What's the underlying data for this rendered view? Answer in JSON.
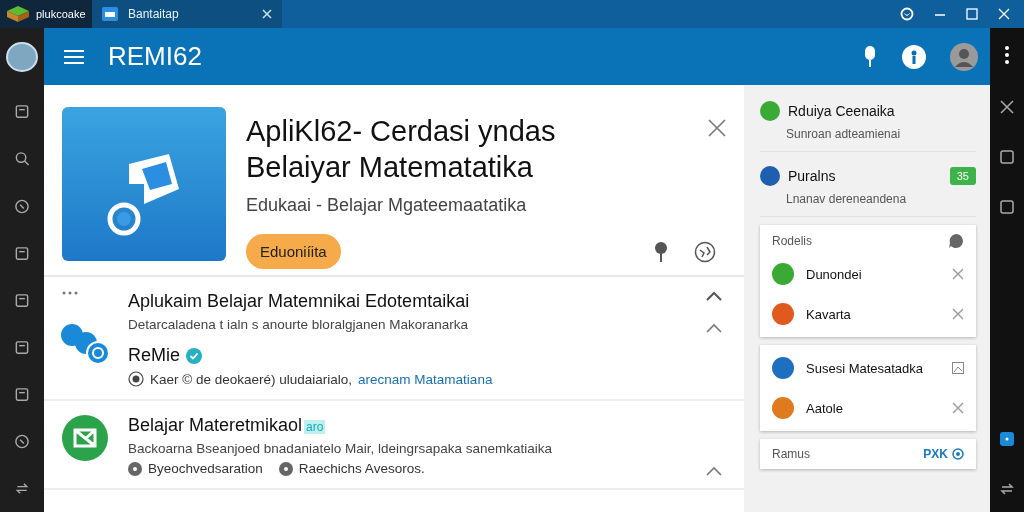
{
  "titlebar": {
    "app_name": "plukcoake",
    "tab": {
      "label": "Bantaitap"
    }
  },
  "appbar": {
    "title": "REMI62"
  },
  "app": {
    "title": "ApliKl62- Cerdasi yndas Belaiyar Matematatika",
    "subtitle": "Edukaai - Belajar Mgateemaatatika",
    "category": "Eduoniíita"
  },
  "list": [
    {
      "title": "Aplukaim Belajar Matemnikai Edotemtaikai",
      "description": "Detarcaladena t ialn s anourte bloralgjanen Makoranarka",
      "author": "ReMie",
      "verified": true,
      "meta": "Kaer © de deokaeré) uludaiarialo,",
      "meta_link": "arecnam Matamatiana"
    },
    {
      "title": "Belajar Materetmikaol",
      "badge": "aro",
      "description": "Backoarna Bseanjoed bnadaniatelo Mair, ldeingrsapaka sanemkatiaika",
      "tags": [
        "Byeochvedsaration",
        "Raechichs Avesoros."
      ]
    }
  ],
  "panel": {
    "top": [
      {
        "title": "Rduiya Ceenaika",
        "subtitle": "Sunroan adteamienai",
        "color": "#3aaa35"
      },
      {
        "title": "Puralns",
        "subtitle": "Lnanav dereneandena",
        "badge": "35",
        "color": "#1e5fb0"
      }
    ],
    "cards": [
      {
        "heading": "Rodelis",
        "items": [
          {
            "label": "Dunondei",
            "color": "#3aaa35"
          },
          {
            "label": "Kavarta",
            "color": "#e05a1e"
          }
        ]
      },
      {
        "items": [
          {
            "label": "Susesi Matesatadka",
            "color": "#1e6fc0"
          },
          {
            "label": "Aatole",
            "color": "#e07a1e"
          }
        ]
      },
      {
        "heading": "Ramus",
        "link": "PXK"
      }
    ]
  }
}
